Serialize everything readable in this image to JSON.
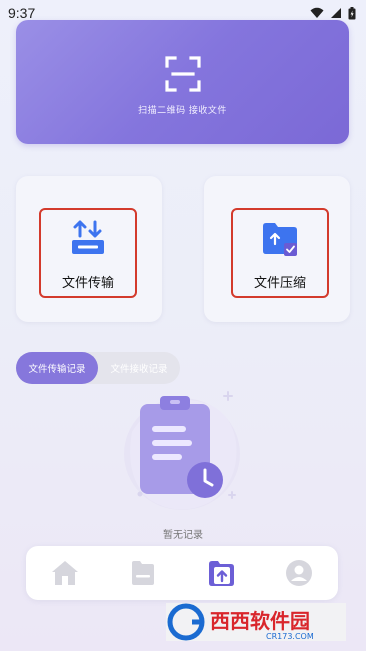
{
  "status_bar": {
    "time": "9:37"
  },
  "scan": {
    "label": "扫描二维码 接收文件"
  },
  "features": [
    {
      "label": "文件传输",
      "icon": "transfer-icon"
    },
    {
      "label": "文件压缩",
      "icon": "compress-folder-icon"
    }
  ],
  "record_tabs": [
    {
      "label": "文件传输记录",
      "active": true
    },
    {
      "label": "文件接收记录",
      "active": false
    }
  ],
  "empty_state": {
    "text": "暂无记录",
    "icon": "empty-clipboard-icon"
  },
  "bottom_nav": [
    {
      "icon": "home-icon",
      "active": false
    },
    {
      "icon": "file-icon",
      "active": false
    },
    {
      "icon": "folder-upload-icon",
      "active": true
    },
    {
      "icon": "profile-icon",
      "active": false
    }
  ],
  "watermark": {
    "text": "西西软件园",
    "domain": "CR173.COM"
  },
  "colors": {
    "accent": "#8677dc",
    "icon_blue": "#3d74ef",
    "highlight_border": "#d33a2c"
  }
}
